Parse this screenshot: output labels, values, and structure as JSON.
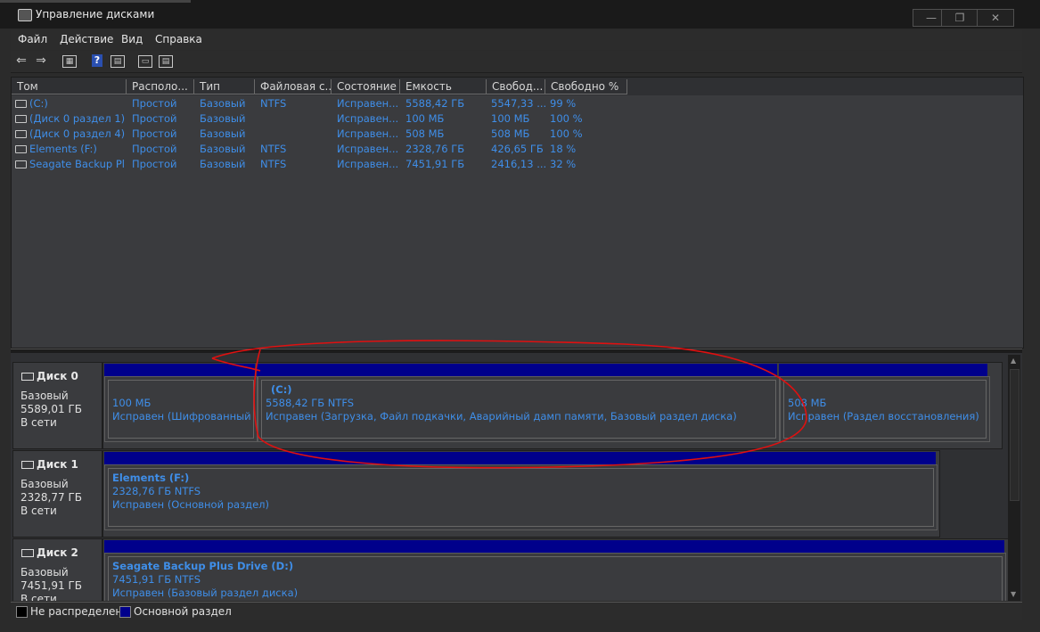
{
  "window": {
    "title": "Управление дисками",
    "min_glyph": "—",
    "max_glyph": "❐",
    "close_glyph": "✕"
  },
  "menu": [
    "Файл",
    "Действие",
    "Вид",
    "Справка"
  ],
  "toolbar": {
    "icons": [
      "back-arrow-icon",
      "forward-arrow-icon",
      "console-tree-icon",
      "help-icon",
      "properties-icon",
      "disk-info-icon",
      "console-icon"
    ],
    "back_glyph": "⇐",
    "forward_glyph": "⇒",
    "help_glyph": "?"
  },
  "volume_list": {
    "columns": [
      "Том",
      "Располо...",
      "Тип",
      "Файловая с...",
      "Состояние",
      "Емкость",
      "Свобод...",
      "Свободно %"
    ],
    "rows": [
      {
        "tom": " (C:)",
        "layout": "Простой",
        "type": "Базовый",
        "fs": "NTFS",
        "status": "Исправен...",
        "capacity": "5588,42 ГБ",
        "free": "5547,33 ...",
        "free_pct": "99 %"
      },
      {
        "tom": "(Диск 0 раздел 1)",
        "layout": "Простой",
        "type": "Базовый",
        "fs": "",
        "status": "Исправен...",
        "capacity": "100 МБ",
        "free": "100 МБ",
        "free_pct": "100 %"
      },
      {
        "tom": "(Диск 0 раздел 4)",
        "layout": "Простой",
        "type": "Базовый",
        "fs": "",
        "status": "Исправен...",
        "capacity": "508 МБ",
        "free": "508 МБ",
        "free_pct": "100 %"
      },
      {
        "tom": "Elements (F:)",
        "layout": "Простой",
        "type": "Базовый",
        "fs": "NTFS",
        "status": "Исправен...",
        "capacity": "2328,76 ГБ",
        "free": "426,65 ГБ",
        "free_pct": "18 %"
      },
      {
        "tom": "Seagate Backup Pl...",
        "layout": "Простой",
        "type": "Базовый",
        "fs": "NTFS",
        "status": "Исправен...",
        "capacity": "7451,91 ГБ",
        "free": "2416,13 ...",
        "free_pct": "32 %"
      }
    ]
  },
  "disks": [
    {
      "name": "Диск 0",
      "kind": "Базовый",
      "size": "5589,01 ГБ",
      "state": "В сети",
      "partitions": [
        {
          "title": "",
          "size_line": "100 МБ",
          "status_line": "Исправен (Шифрованный (E"
        },
        {
          "title": "(C:)",
          "size_line": "5588,42 ГБ NTFS",
          "status_line": "Исправен (Загрузка, Файл подкачки, Аварийный дамп памяти, Базовый раздел диска)"
        },
        {
          "title": "",
          "size_line": "508 МБ",
          "status_line": "Исправен (Раздел восстановления)"
        }
      ]
    },
    {
      "name": "Диск 1",
      "kind": "Базовый",
      "size": "2328,77 ГБ",
      "state": "В сети",
      "partitions": [
        {
          "title": "Elements  (F:)",
          "size_line": "2328,76 ГБ NTFS",
          "status_line": "Исправен (Основной раздел)"
        }
      ]
    },
    {
      "name": "Диск 2",
      "kind": "Базовый",
      "size": "7451,91 ГБ",
      "state": "В сети",
      "partitions": [
        {
          "title": "Seagate Backup Plus Drive  (D:)",
          "size_line": "7451,91 ГБ NTFS",
          "status_line": "Исправен (Базовый раздел диска)"
        }
      ]
    }
  ],
  "legend": {
    "unallocated": "Не распределена",
    "primary": "Основной раздел",
    "unallocated_color": "#000000",
    "primary_color": "#00008b"
  },
  "colors": {
    "accent_text": "#3f8ee8",
    "annotation": "#e01010"
  }
}
